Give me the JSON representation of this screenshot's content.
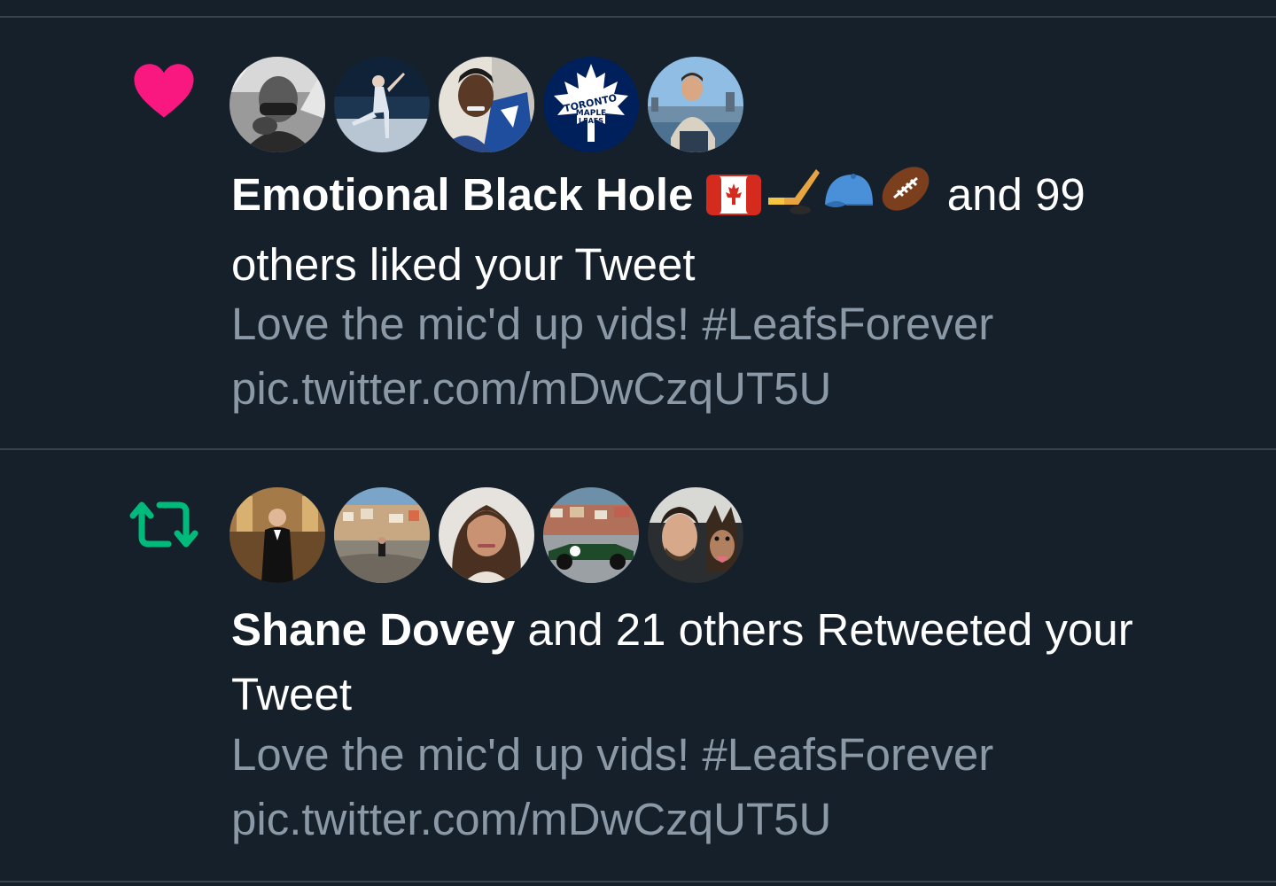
{
  "colors": {
    "background": "#15202b",
    "divider": "#38444d",
    "like": "#f91880",
    "retweet": "#00ba7c",
    "primary_text": "#ffffff",
    "secondary_text": "#8b98a5"
  },
  "notifications": [
    {
      "type": "like",
      "icon": "heart-icon",
      "avatars": [
        "avatar-man-bw",
        "avatar-figure-skater",
        "avatar-man-selfie",
        "avatar-maple-leafs-logo",
        "avatar-man-city"
      ],
      "actor_name": "Emotional Black Hole",
      "actor_emojis": [
        "canada-flag",
        "hockey-stick",
        "blue-cap",
        "football"
      ],
      "action_text": " and 99 others liked your Tweet",
      "tweet_text": "Love the mic'd up vids! #LeafsForever",
      "tweet_link": "pic.twitter.com/mDwCzqUT5U"
    },
    {
      "type": "retweet",
      "icon": "retweet-icon",
      "avatars": [
        "avatar-man-tuxedo",
        "avatar-person-coast",
        "avatar-woman-curls",
        "avatar-race-car",
        "avatar-man-dog"
      ],
      "actor_name": "Shane Dovey",
      "action_text": " and 21 others Retweeted your Tweet",
      "tweet_text": "Love the mic'd up vids! #LeafsForever",
      "tweet_link": "pic.twitter.com/mDwCzqUT5U"
    }
  ],
  "avatar_logo_text": [
    "TORONTO",
    "MAPLE",
    "LEAFS"
  ]
}
